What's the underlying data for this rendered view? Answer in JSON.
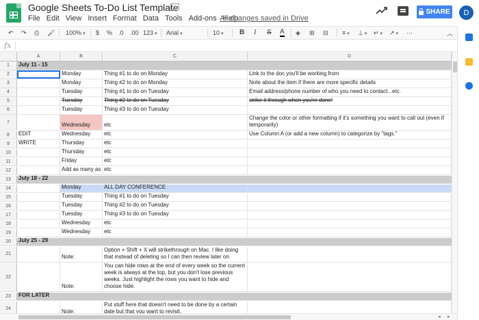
{
  "header": {
    "doc_title": "Google Sheets To-Do List Template",
    "save_status": "All changes saved in Drive",
    "share_label": "SHARE",
    "avatar_initial": "D",
    "menu": [
      "File",
      "Edit",
      "View",
      "Insert",
      "Format",
      "Data",
      "Tools",
      "Add-ons",
      "Help"
    ]
  },
  "toolbar": {
    "zoom": "100%",
    "currency": "$",
    "percent": "%",
    "decimal_less": ".0",
    "decimal_more": ".00",
    "format_more": "123",
    "font": "Arial",
    "font_size": "10",
    "bold": "B",
    "italic": "I",
    "strikethrough": "S",
    "text_color": "A"
  },
  "formula_bar": {
    "fx_label": "fx",
    "value": ""
  },
  "columns": [
    "A",
    "B",
    "C",
    "D"
  ],
  "rows": [
    {
      "n": "1",
      "type": "week",
      "a": "July 11 - 15",
      "b": "",
      "c": "",
      "d": ""
    },
    {
      "n": "2",
      "a": "",
      "b": "Monday",
      "c": "Thing #1 to do on Monday",
      "d": "Link to the doc you'll be working from",
      "selected_a": true
    },
    {
      "n": "3",
      "a": "",
      "b": "Monday",
      "c": "Thing #2 to do on Monday",
      "d": "Note about the item if there are more specific details"
    },
    {
      "n": "4",
      "a": "",
      "b": "Tuesday",
      "c": "Thing #1 to do on Tuesday",
      "d": "Email address/phone number of who you need to contact...etc."
    },
    {
      "n": "5",
      "a": "",
      "b": "Tuesday",
      "c": "Thing #2 to do on Tuesday",
      "d": "strike it through when you're done!",
      "strike": true
    },
    {
      "n": "6",
      "a": "",
      "b": "Tuesday",
      "c": "Thing #3 to do on Tuesday",
      "d": ""
    },
    {
      "n": "7",
      "a": "",
      "b": "Wednesday",
      "c": "etc",
      "d": "Change the color or other formatting if it's something you want to call out (even if temporarily)",
      "tall": true,
      "pink_b": true
    },
    {
      "n": "8",
      "a": "EDIT",
      "b": "Wednesday",
      "c": "etc",
      "d": "Use Column A (or add a new column) to categorize by \"tags.\""
    },
    {
      "n": "9",
      "a": "WRITE",
      "b": "Thursday",
      "c": "etc",
      "d": ""
    },
    {
      "n": "10",
      "a": "",
      "b": "Thursday",
      "c": "etc",
      "d": ""
    },
    {
      "n": "11",
      "a": "",
      "b": "Friday",
      "c": "etc",
      "d": ""
    },
    {
      "n": "12",
      "a": "",
      "b": "Add as many as",
      "c": "etc",
      "d": ""
    },
    {
      "n": "13",
      "type": "week",
      "a": "July 18 - 22",
      "b": "",
      "c": "",
      "d": ""
    },
    {
      "n": "14",
      "a": "",
      "b": "Monday",
      "c": "ALL DAY CONFERENCE",
      "d": "",
      "blue": true
    },
    {
      "n": "15",
      "a": "",
      "b": "Tuesday",
      "c": "Thing #1 to do on Tuesday",
      "d": ""
    },
    {
      "n": "16",
      "a": "",
      "b": "Tuesday",
      "c": "Thing #2 to do on Tuesday",
      "d": ""
    },
    {
      "n": "17",
      "a": "",
      "b": "Tuesday",
      "c": "Thing #3 to do on Tuesday",
      "d": ""
    },
    {
      "n": "18",
      "a": "",
      "b": "Wednesday",
      "c": "etc",
      "d": ""
    },
    {
      "n": "19",
      "a": "",
      "b": "Wednesday",
      "c": "etc",
      "d": ""
    },
    {
      "n": "20",
      "type": "week",
      "a": "July 25 - 29",
      "b": "",
      "c": "",
      "d": ""
    },
    {
      "n": "21",
      "a": "",
      "b": "Note:",
      "c": "Option + Shift + X will strikethrough on Mac. I like doing that instead of deleting so I can then review later on",
      "d": "",
      "tall": true
    },
    {
      "n": "22",
      "a": "",
      "b": "Note:",
      "c": "You can hide rows at the end of every week so the current week is always at the top, but you don't lose previous weeks. Just highlight the rows you want to hide and choose hide.",
      "d": "",
      "xtall": true
    },
    {
      "n": "23",
      "type": "week",
      "a": "FOR LATER",
      "b": "",
      "c": "",
      "d": ""
    },
    {
      "n": "24",
      "a": "",
      "b": "Note:",
      "c": "Put stuff here that doesn't need to be done by a certain date but that you want to revisit.",
      "d": "",
      "tall": true
    }
  ]
}
